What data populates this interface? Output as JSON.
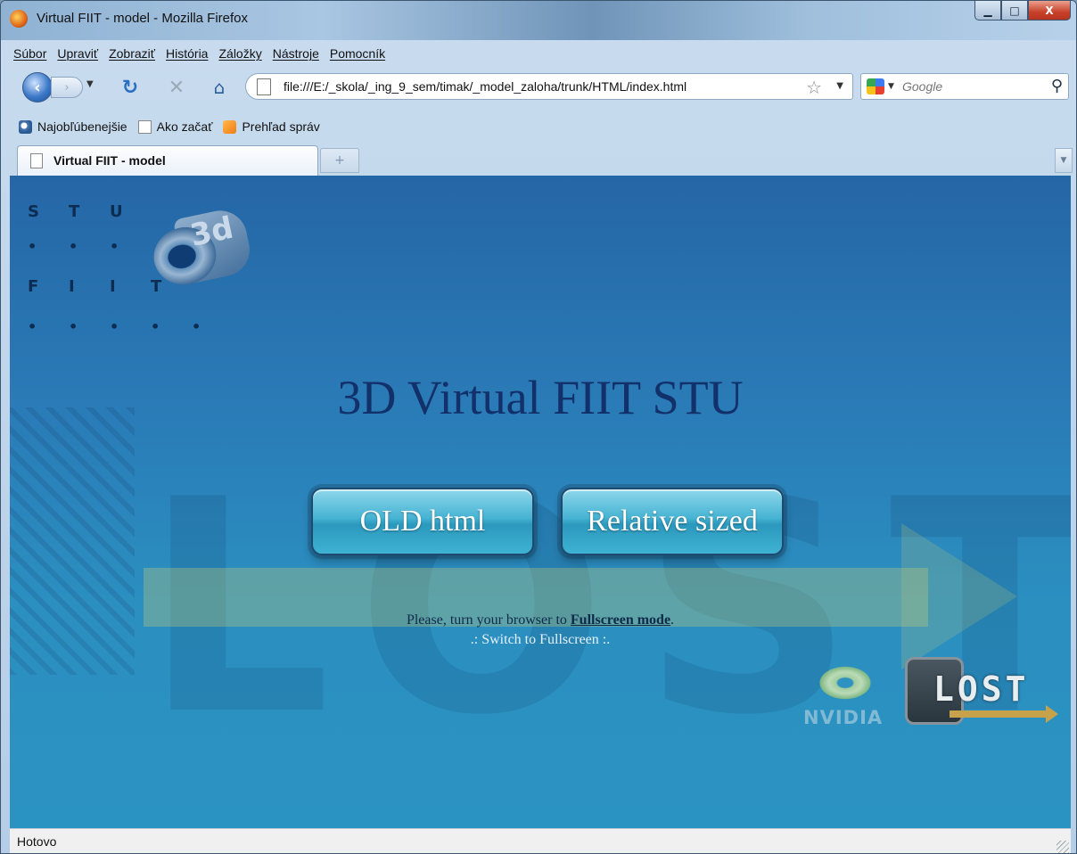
{
  "window": {
    "title": "Virtual FIIT - model - Mozilla Firefox"
  },
  "window_controls": {
    "minimize": "▁",
    "maximize": "□",
    "close": "X"
  },
  "menu": [
    "Súbor",
    "Upraviť",
    "Zobraziť",
    "História",
    "Záložky",
    "Nástroje",
    "Pomocník"
  ],
  "nav": {
    "url": "file:///E:/_skola/_ing_9_sem/timak/_model_zaloha/trunk/HTML/index.html",
    "search_placeholder": "Google"
  },
  "bookmarks": [
    {
      "label": "Najobľúbenejšie",
      "icon": "search-folder-icon"
    },
    {
      "label": "Ako začať",
      "icon": "page-icon"
    },
    {
      "label": "Prehľad správ",
      "icon": "rss-icon"
    }
  ],
  "tabs": [
    {
      "label": "Virtual FIIT - model",
      "active": true
    }
  ],
  "content": {
    "logo_letters": {
      "row1": [
        "S",
        "T",
        "U"
      ],
      "row3": [
        "F",
        "I",
        "I",
        "T"
      ]
    },
    "logo_3d_text": "3d",
    "headline": "3D Virtual FIIT STU",
    "button_old": "OLD html",
    "button_relative": "Relative sized",
    "notice_prefix": "Please, turn your browser to ",
    "notice_link": "Fullscreen mode",
    "notice_suffix": ".",
    "switch_text": ".: Switch to Fullscreen :.",
    "nvidia_text": "NVIDIA",
    "lost_text": "LOST",
    "bg_text": "LOST"
  },
  "status": {
    "text": "Hotovo"
  },
  "colors": {
    "content_bg": "#2a7bb7",
    "headline": "#12306a",
    "button": "#45b3d3"
  }
}
